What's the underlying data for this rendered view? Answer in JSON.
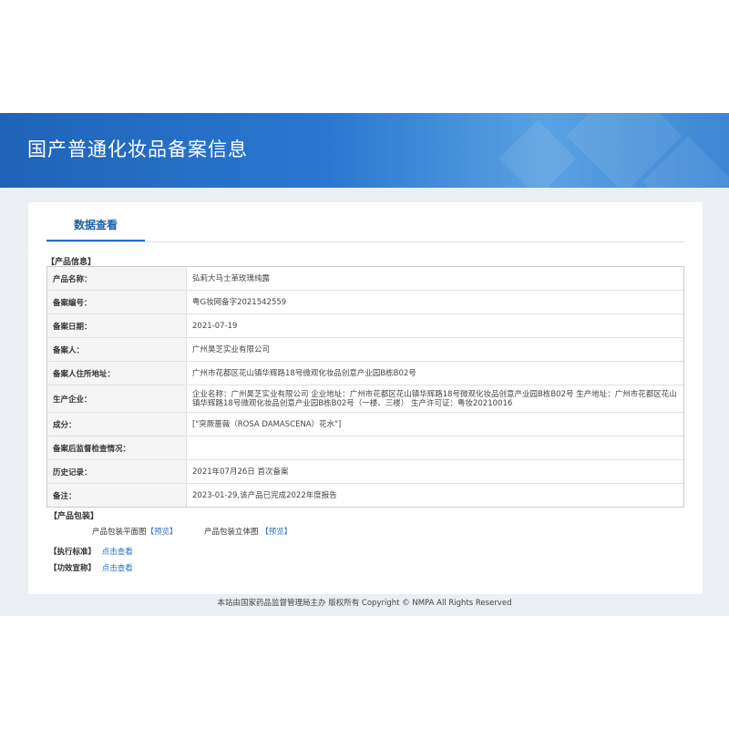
{
  "banner": {
    "title": "国产普通化妆品备案信息"
  },
  "tabs": {
    "active": "数据查看"
  },
  "product_info": {
    "section_title": "【产品信息】",
    "rows": [
      {
        "label": "产品名称：",
        "value": "弘莉大马士革玫瑰纯露"
      },
      {
        "label": "备案编号：",
        "value": "粤G妆网备字2021542559"
      },
      {
        "label": "备案日期：",
        "value": "2021-07-19"
      },
      {
        "label": "备案人：",
        "value": "广州昊芝实业有限公司"
      },
      {
        "label": "备案人住所地址：",
        "value": "广州市花都区花山镇华辉路18号微观化妆品创意产业园B栋B02号"
      },
      {
        "label": "生产企业：",
        "value": "企业名称：广州昊芝实业有限公司 企业地址：广州市花都区花山镇华辉路18号微观化妆品创意产业园B栋B02号 生产地址：广州市花都区花山镇华辉路18号微观化妆品创意产业园B栋B02号（一楼、三楼） 生产许可证：粤妆20210016"
      },
      {
        "label": "成分：",
        "value": "[\"突厥蔷薇（ROSA DAMASCENA）花水\"]"
      },
      {
        "label": "备案后监督检查情况：",
        "value": ""
      },
      {
        "label": "历史记录：",
        "value": "2021年07月26日 首次备案"
      },
      {
        "label": "备注：",
        "value": "2023-01-29,该产品已完成2022年度报告"
      }
    ]
  },
  "packaging": {
    "section_title": "【产品包装】",
    "flat_label": "产品包装平面图",
    "flat_link": "【预览】",
    "solid_label": "产品包装立体图",
    "solid_link": "【预览】"
  },
  "standard": {
    "label": "【执行标准】",
    "link": "点击查看"
  },
  "claims": {
    "label": "【功效宣称】",
    "link": "点击查看"
  },
  "footer": {
    "text": "本站由国家药品监督管理局主办 版权所有 Copyright © NMPA All Rights Reserved"
  },
  "colors": {
    "banner": "#2a78d0",
    "link": "#2b6fc2",
    "tab_active": "#1f6ec6",
    "page_bg": "#ebeef3"
  }
}
